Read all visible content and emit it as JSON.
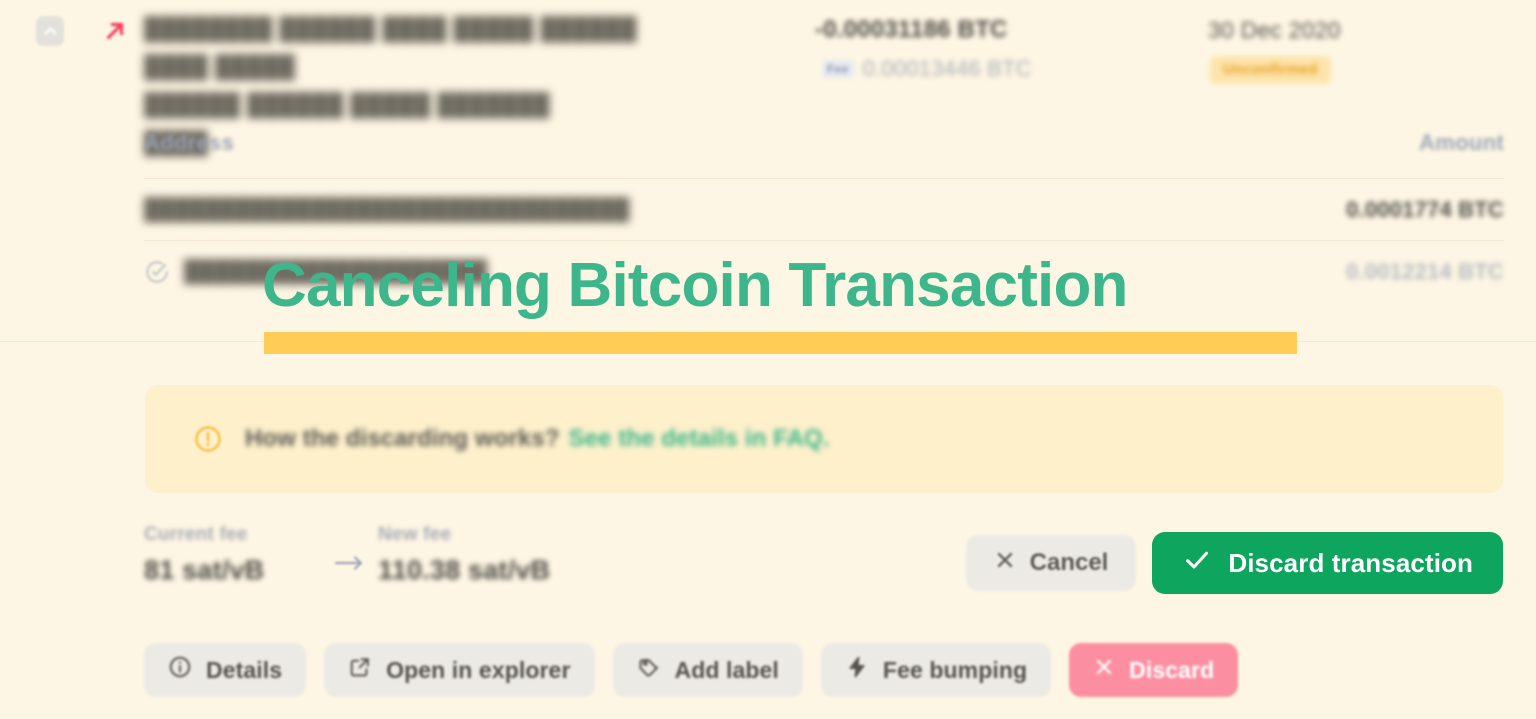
{
  "theme": {
    "background": "#fdf6e4",
    "accent_green": "#3cb68a",
    "accent_green_solid": "#0ea55f",
    "accent_amber": "#ffcc55",
    "banner_bg": "#fdf0cb",
    "danger_pink": "#fb8fa1",
    "muted_text": "#9aa3b6"
  },
  "transaction": {
    "hash_line1": "████████ ██████ ████ █████ ██████ ████ █████",
    "hash_line2": "██████ ██████ █████ ███████ ████",
    "amount": "-0.00031186 BTC",
    "fee_chip_label": "Fee",
    "fee_amount": "0.00013446 BTC",
    "date": "30 Dec 2020",
    "status": "Unconfirmed",
    "direction_icon": "outgoing-arrow-icon",
    "collapse_icon": "chevron-up-icon"
  },
  "io_table": {
    "header": {
      "address": "Address",
      "amount": "Amount"
    },
    "rows": [
      {
        "address": "████████████████████████████████",
        "amount": "0.0001774 BTC",
        "type": "recipient",
        "icon": null
      },
      {
        "address": "████████████████████",
        "amount": "0.0012214 BTC",
        "type": "change",
        "icon": "check-circle-icon"
      }
    ]
  },
  "overlay": {
    "title": "Canceling Bitcoin Transaction"
  },
  "faq_banner": {
    "icon": "exclamation-circle-icon",
    "question": "How the discarding works?",
    "link_text": "See the details in FAQ."
  },
  "fee_compare": {
    "current_label": "Current fee",
    "current_value": "81 sat/vB",
    "arrow_icon": "arrow-right-icon",
    "new_label": "New fee",
    "new_value": "110.38 sat/vB"
  },
  "confirm_actions": {
    "cancel_label": "Cancel",
    "cancel_icon": "close-x-icon",
    "discard_label": "Discard transaction",
    "discard_icon": "check-icon"
  },
  "toolbar": {
    "items": [
      {
        "label": "Details",
        "icon": "info-circle-icon"
      },
      {
        "label": "Open in explorer",
        "icon": "external-link-icon"
      },
      {
        "label": "Add label",
        "icon": "tag-icon"
      },
      {
        "label": "Fee bumping",
        "icon": "lightning-bolt-icon"
      },
      {
        "label": "Discard",
        "icon": "close-x-icon"
      }
    ]
  }
}
